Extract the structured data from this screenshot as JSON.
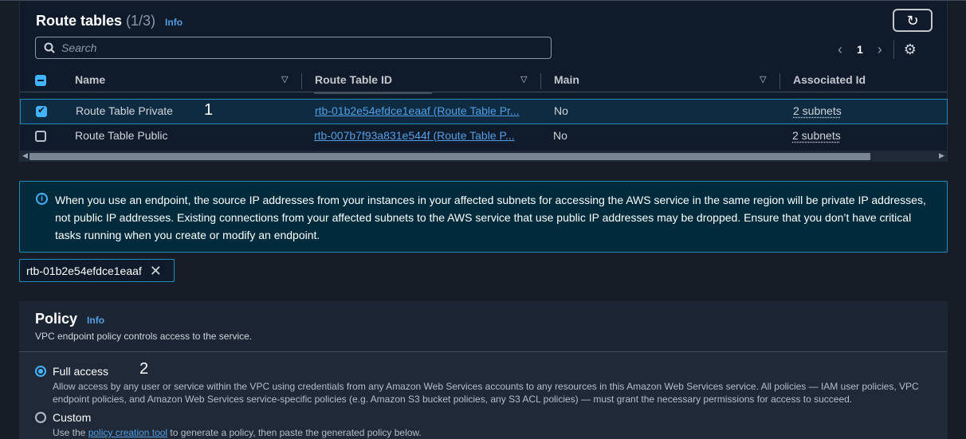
{
  "route_tables": {
    "title": "Route tables",
    "count": "(1/3)",
    "info": "Info",
    "search_placeholder": "Search",
    "page": "1",
    "columns": [
      "Name",
      "Route Table ID",
      "Main",
      "Associated Id"
    ],
    "rows": [
      {
        "name": "Route Table Private",
        "id": "rtb-01b2e54efdce1eaaf (Route Table Pr...",
        "main": "No",
        "assoc": "2 subnets",
        "selected": true
      },
      {
        "name": "Route Table Public",
        "id": "rtb-007b7f93a831e544f (Route Table P...",
        "main": "No",
        "assoc": "2 subnets",
        "selected": false
      }
    ],
    "annotation": "1"
  },
  "alert": {
    "text": "When you use an endpoint, the source IP addresses from your instances in your affected subnets for accessing the AWS service in the same region will be private IP addresses, not public IP addresses. Existing connections from your affected subnets to the AWS service that use public IP addresses may be dropped. Ensure that you don’t have critical tasks running when you create or modify an endpoint."
  },
  "token": {
    "label": "rtb-01b2e54efdce1eaaf"
  },
  "policy": {
    "title": "Policy",
    "info": "Info",
    "description": "VPC endpoint policy controls access to the service.",
    "annotation": "2",
    "options": [
      {
        "label": "Full access",
        "checked": true,
        "description": "Allow access by any user or service within the VPC using credentials from any Amazon Web Services accounts to any resources in this Amazon Web Services service. All policies — IAM user policies, VPC endpoint policies, and Amazon Web Services service-specific policies (e.g. Amazon S3 bucket policies, any S3 ACL policies) — must grant the necessary permissions for access to succeed."
      },
      {
        "label": "Custom",
        "checked": false,
        "description_pre": "Use the ",
        "description_link": "policy creation tool",
        "description_post": " to generate a policy, then paste the generated policy below."
      }
    ]
  },
  "colors": {
    "accent": "#42b4ff",
    "link": "#539fe5",
    "selected_row": "#0e2b42",
    "alert_bg": "#002b3d"
  },
  "icons": [
    "search-icon",
    "refresh-icon",
    "chevron-left-icon",
    "chevron-right-icon",
    "gear-icon",
    "sort-icon",
    "info-circle-icon",
    "close-icon"
  ]
}
